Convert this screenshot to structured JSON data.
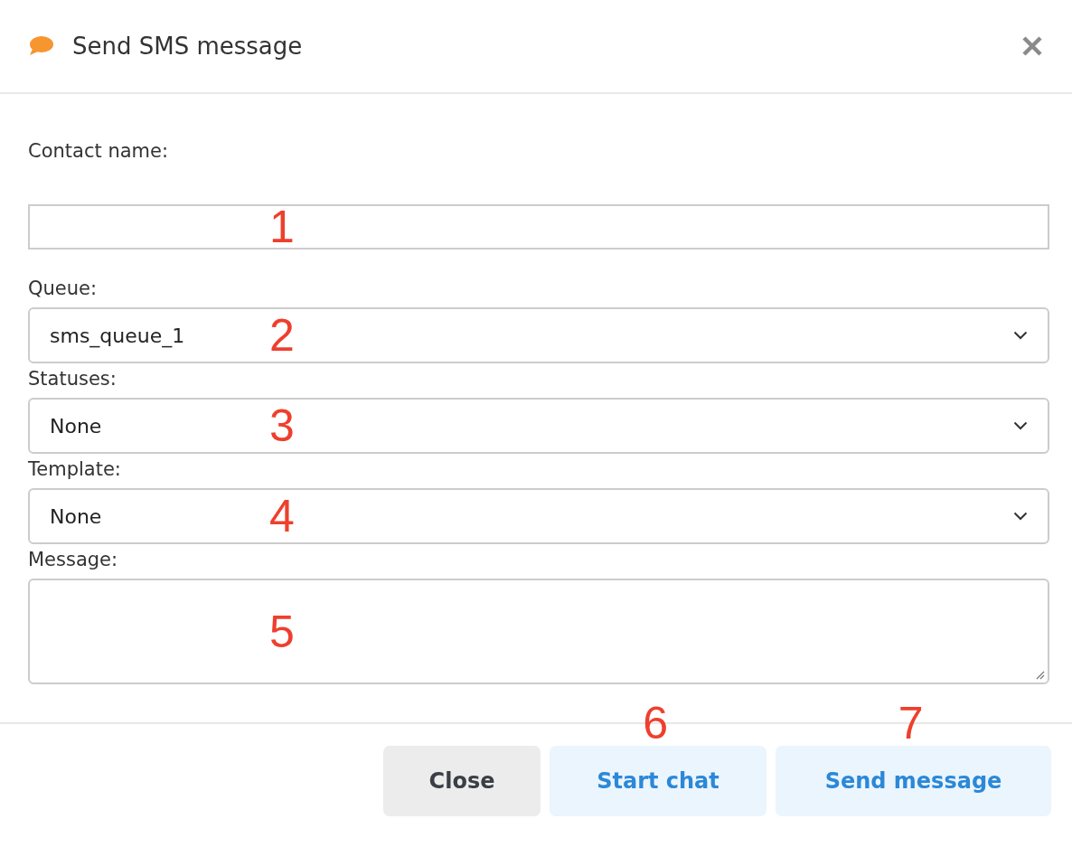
{
  "dialog": {
    "title": "Send SMS message"
  },
  "fields": [
    {
      "kind": "text",
      "label": "Contact name:",
      "marker": "1"
    },
    {
      "kind": "select",
      "label": "Queue:",
      "value": "sms_queue_1",
      "marker": "2"
    },
    {
      "kind": "select",
      "label": "Statuses:",
      "value": "None",
      "marker": "3"
    },
    {
      "kind": "select",
      "label": "Template:",
      "value": "None",
      "marker": "4"
    },
    {
      "kind": "textarea",
      "label": "Message:",
      "marker": "5"
    }
  ],
  "buttons": [
    {
      "kind": "secondary",
      "label": "Close"
    },
    {
      "kind": "primary",
      "label": "Start chat",
      "marker": "6"
    },
    {
      "kind": "primary",
      "label": "Send message",
      "marker": "7"
    }
  ]
}
